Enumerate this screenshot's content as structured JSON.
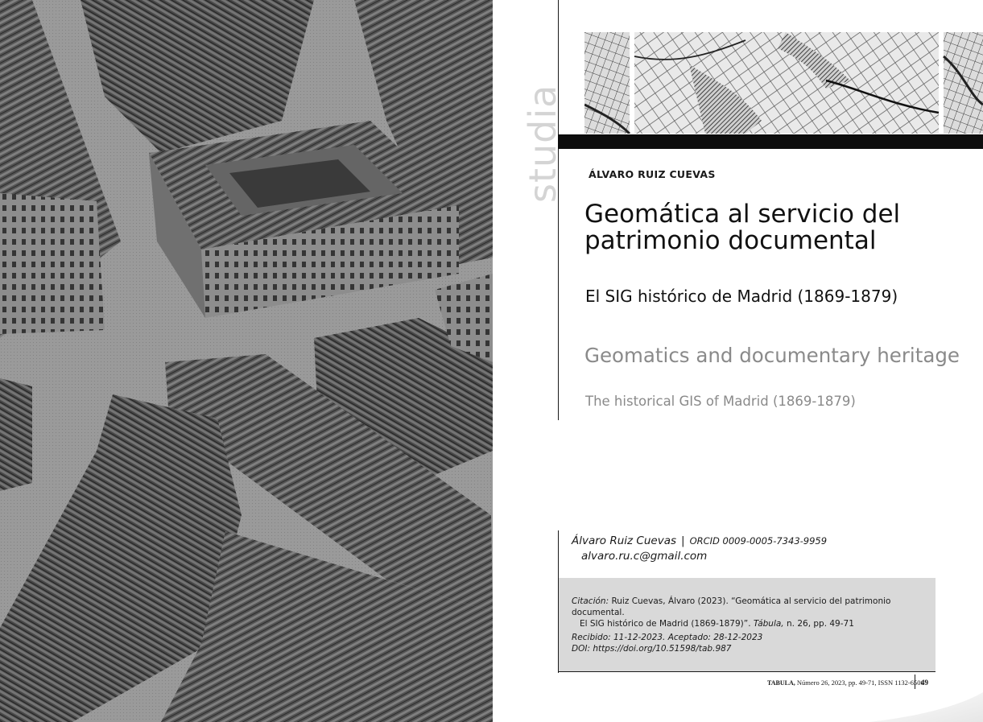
{
  "section_label": "studia",
  "author_caps": "ÁLVARO RUIZ CUEVAS",
  "title_es": "Geomática al servicio del patrimonio documental",
  "subtitle_es": "El SIG histórico de Madrid (1869-1879)",
  "title_en": "Geomatics and documentary heritage",
  "subtitle_en": "The historical GIS of Madrid (1869-1879)",
  "contact": {
    "name": "Álvaro Ruiz Cuevas",
    "separator": "|",
    "orcid": "ORCID 0009-0005-7343-9959",
    "email": "alvaro.ru.c@gmail.com"
  },
  "citation": {
    "label": "Citación:",
    "text_line1": "Ruiz Cuevas, Álvaro (2023). “Geomática al servicio del patrimonio documental.",
    "text_line2_a": "El SIG histórico de Madrid (1869-1879)”.",
    "journal": "Tábula,",
    "text_line2_b": "n. 26, pp. 49-71",
    "received": "Recibido: 11-12-2023. Aceptado: 28-12-2023",
    "doi": "DOI: https://doi.org/10.51598/tab.987"
  },
  "footer": {
    "brand": "TABULA,",
    "info": "Número 26, 2023, pp. 49-71, ISSN 1132-6506",
    "page_number": "49"
  },
  "colors": {
    "ink": "#1a1a1a",
    "grey_text": "#8a8a8a",
    "studia_grey": "#d4d4d4",
    "citation_bg": "#d9d9d9",
    "bar": "#0d0d0d"
  }
}
